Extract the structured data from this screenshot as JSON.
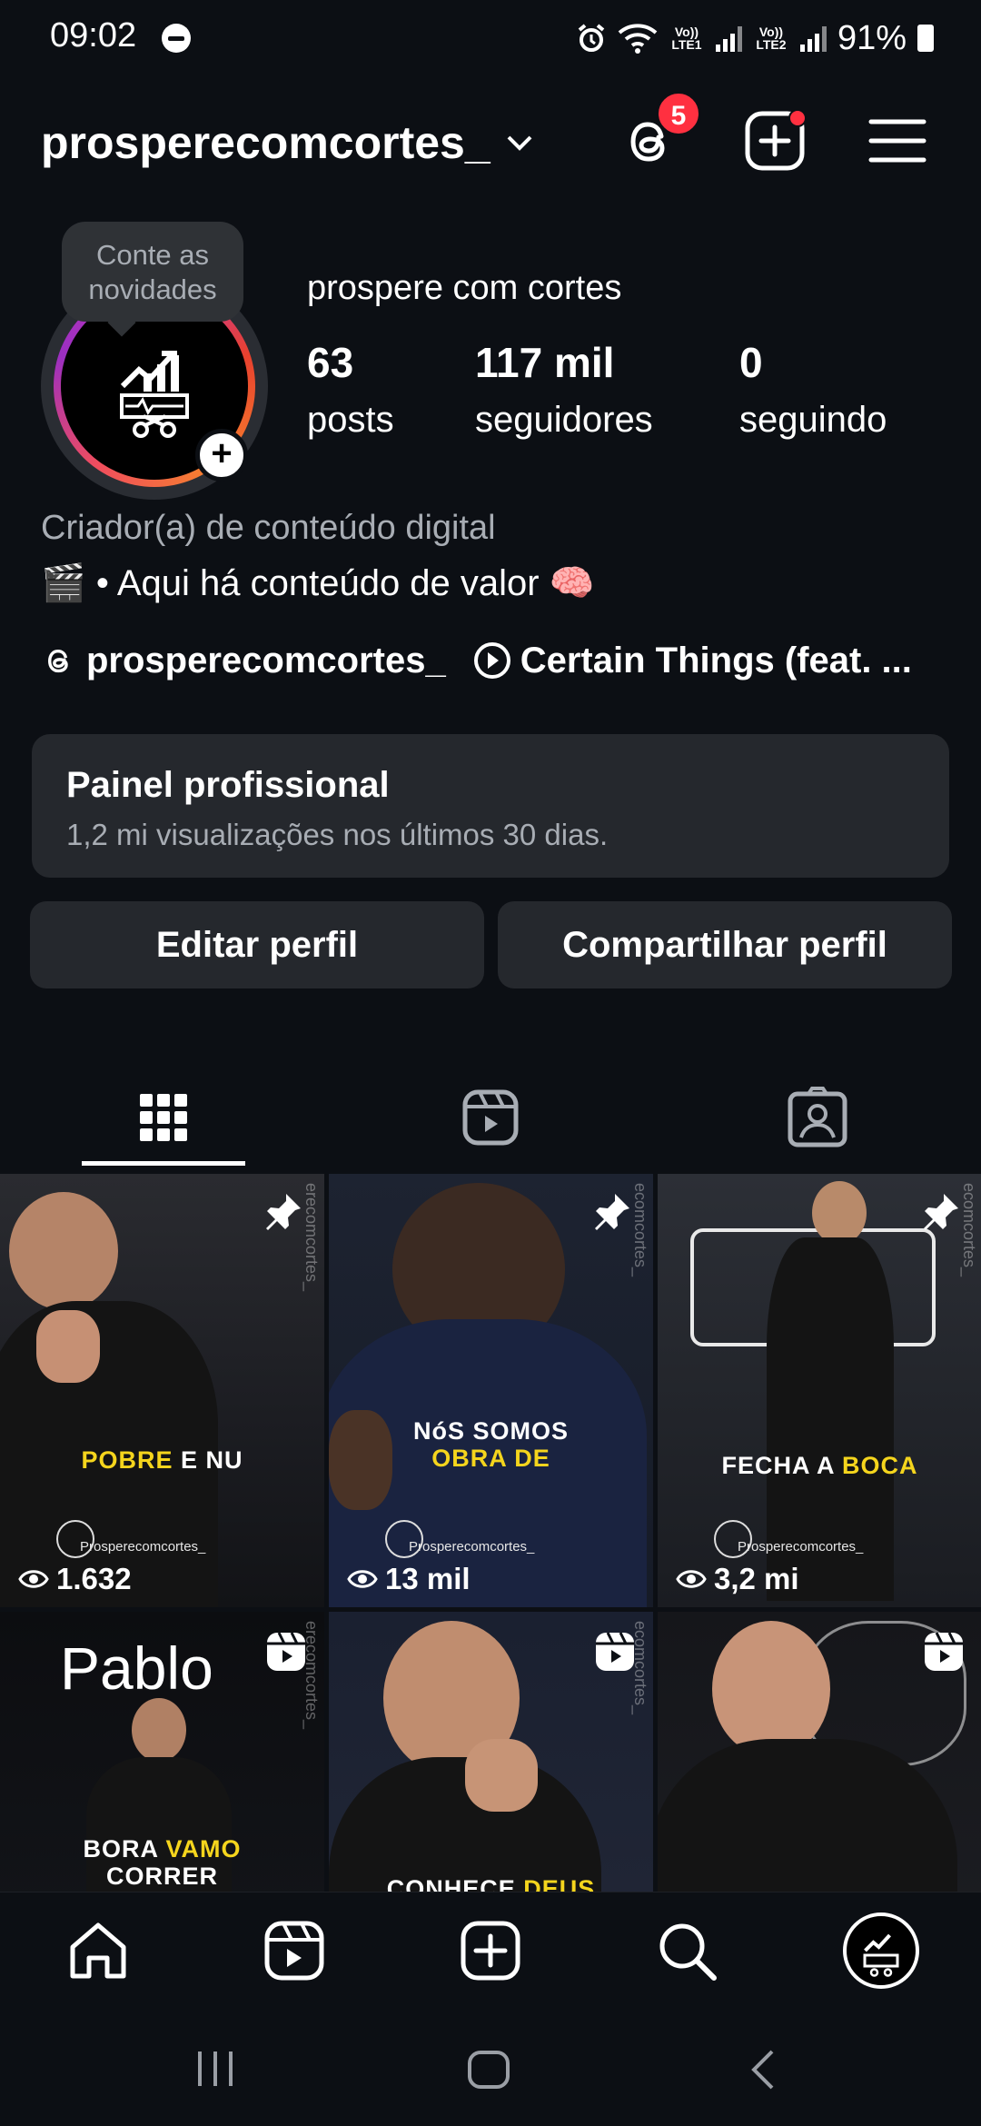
{
  "status_bar": {
    "time": "09:02",
    "sim1": "Vo)) LTE1",
    "sim2": "Vo)) LTE2",
    "battery": "91%"
  },
  "header": {
    "username": "prosperecomcortes_",
    "threads_badge": "5"
  },
  "profile": {
    "tooltip": "Conte as novidades",
    "display_name": "prospere com cortes",
    "stats": [
      {
        "value": "63",
        "label": "posts"
      },
      {
        "value": "117 mil",
        "label": "seguidores"
      },
      {
        "value": "0",
        "label": "seguindo"
      }
    ],
    "category": "Criador(a) de conteúdo digital",
    "bio": "🎬 • Aqui há conteúdo de valor 🧠",
    "threads_link": "prosperecomcortes_",
    "music_link": "Certain Things (feat. ..."
  },
  "pro_panel": {
    "title": "Painel profissional",
    "subtitle": "1,2 mi visualizações nos últimos 30 dias."
  },
  "buttons": {
    "edit": "Editar perfil",
    "share": "Compartilhar perfil"
  },
  "posts": [
    {
      "caption_a": "POBRE",
      "caption_b": " E NU",
      "views": "1.632",
      "watermark": "Prosperecomcortes_",
      "side": "erecomcortes_",
      "type": "pinned"
    },
    {
      "caption_a": "NóS SOMOS",
      "caption_b": "OBRA DE",
      "views": "13 mil",
      "watermark": "Prosperecomcortes_",
      "side": "ecomcortes_",
      "type": "pinned"
    },
    {
      "caption_a": "FECHA A ",
      "caption_b": "BOCA",
      "views": "3,2 mi",
      "watermark": "Prosperecomcortes_",
      "side": "ecomcortes_",
      "type": "pinned"
    },
    {
      "caption_a": "BORA ",
      "caption_b": "VAMO",
      "caption_c": "CORRER",
      "overlay": "Pablo",
      "side": "erecomcortes_",
      "type": "reel"
    },
    {
      "caption_a": "CONHECE ",
      "caption_b": "DEUS",
      "side": "ecomcortes_",
      "type": "reel"
    },
    {
      "type": "reel"
    }
  ]
}
